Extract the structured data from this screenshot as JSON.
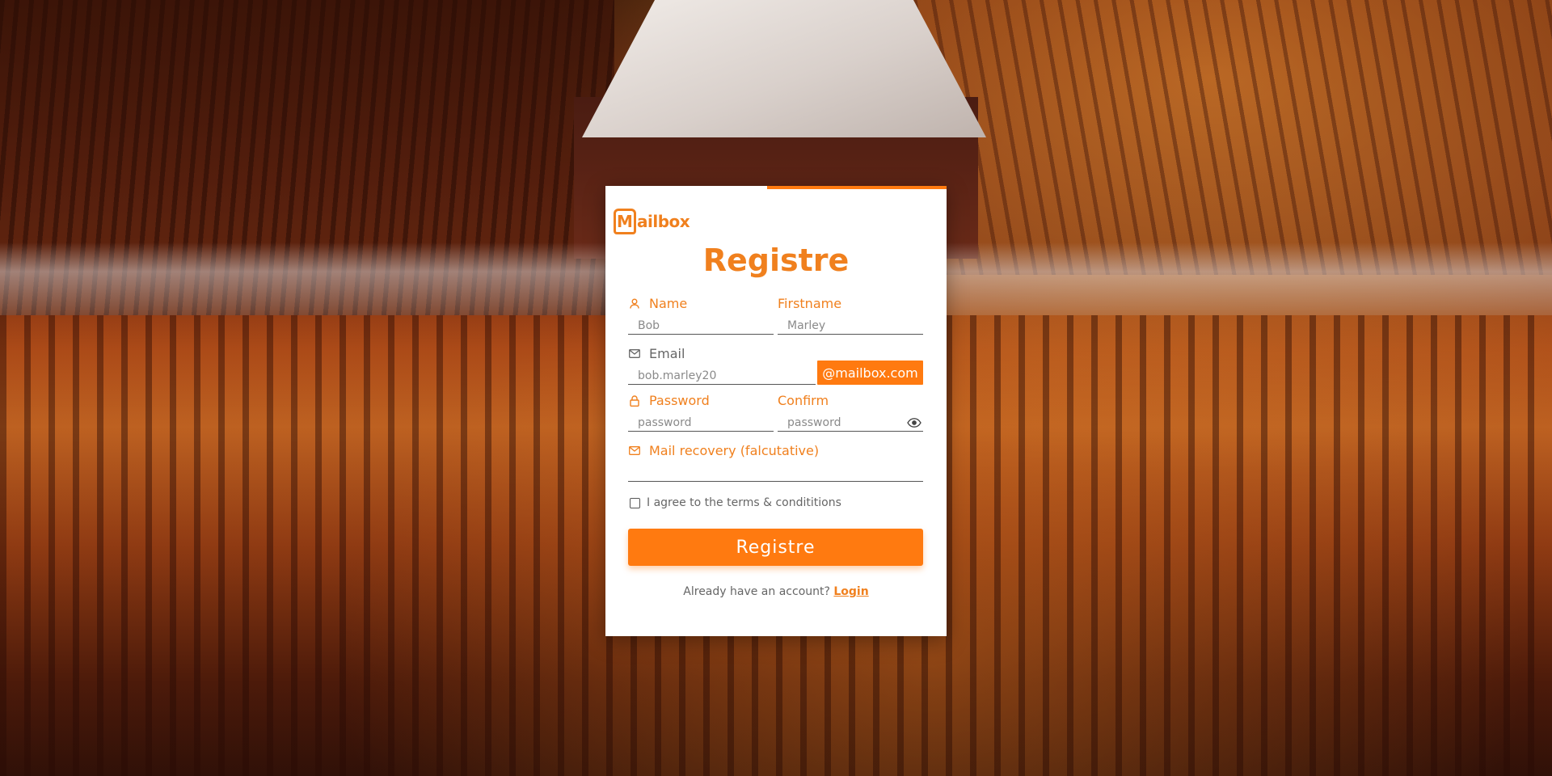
{
  "brand": {
    "logo_mark": "M",
    "logo_text": "ailbox",
    "accent": "#ff7a10"
  },
  "form": {
    "title": "Registre",
    "name": {
      "label": "Name",
      "placeholder": "Bob",
      "icon": "user-icon"
    },
    "firstname": {
      "label": "Firstname",
      "placeholder": "Marley"
    },
    "email": {
      "label": "Email",
      "placeholder": "bob.marley20",
      "icon": "mail-icon",
      "domain": "@mailbox.com"
    },
    "password": {
      "label": "Password",
      "placeholder": "password",
      "icon": "lock-icon"
    },
    "confirm": {
      "label": "Confirm",
      "placeholder": "password",
      "icon": "eye-icon"
    },
    "recovery": {
      "label": "Mail recovery (falcutative)",
      "icon": "mail-icon"
    },
    "terms_label": "I agree to the terms & condititions",
    "submit_label": "Registre",
    "footer_text": "Already have an account?",
    "login_link": "Login"
  }
}
